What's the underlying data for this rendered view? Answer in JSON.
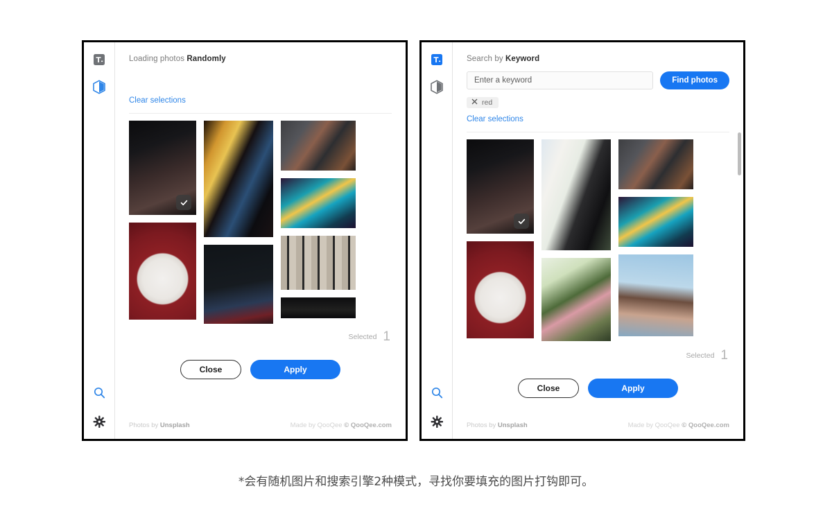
{
  "panels": [
    {
      "id": "random",
      "mode": "random",
      "header": {
        "prefix": "Loading photos ",
        "strong": "Randomly"
      },
      "show_search": false,
      "clear_label": "Clear selections",
      "selected": {
        "label": "Selected",
        "count": "1"
      },
      "buttons": {
        "close": "Close",
        "apply": "Apply"
      },
      "footer": {
        "left_prefix": "Photos by ",
        "left_strong": "Unsplash",
        "right_prefix": "Made by QooQee ",
        "right_symbol": "©",
        "right_strong": " QooQee.com"
      },
      "rail": {
        "text_icon": "text-tool-icon",
        "text_icon_active": false,
        "shape_icon": "hexagon-shape-icon",
        "shape_icon_active": true,
        "search_icon": "search-icon",
        "settings_icon": "gear-icon"
      },
      "scrollbar_visible": false,
      "photos": [
        {
          "name": "dark-building-corner",
          "col": 0,
          "h": 136,
          "selected": true,
          "theme": "building-dark"
        },
        {
          "name": "red-circle-bridge",
          "col": 0,
          "h": 140,
          "selected": false,
          "theme": "red-bridge"
        },
        {
          "name": "shop-window-night",
          "col": 1,
          "h": 168,
          "selected": false,
          "theme": "window-shop"
        },
        {
          "name": "car-hood-dark",
          "col": 1,
          "h": 120,
          "selected": false,
          "theme": "car-dark"
        },
        {
          "name": "person-on-couch",
          "col": 2,
          "h": 72,
          "selected": false,
          "theme": "couch"
        },
        {
          "name": "neon-diner-night",
          "col": 2,
          "h": 72,
          "selected": false,
          "theme": "diner"
        },
        {
          "name": "apartment-facade",
          "col": 2,
          "h": 78,
          "selected": false,
          "theme": "facade"
        },
        {
          "name": "dark-strip",
          "col": 2,
          "h": 30,
          "selected": false,
          "theme": "strip"
        }
      ]
    },
    {
      "id": "search",
      "mode": "keyword",
      "header": {
        "prefix": "Search by ",
        "strong": "Keyword"
      },
      "show_search": true,
      "search": {
        "placeholder": "Enter a keyword",
        "value": "",
        "button_label": "Find photos",
        "tags": [
          {
            "label": "red",
            "remove_icon": "close-x-icon"
          }
        ]
      },
      "clear_label": "Clear selections",
      "selected": {
        "label": "Selected",
        "count": "1"
      },
      "buttons": {
        "close": "Close",
        "apply": "Apply"
      },
      "footer": {
        "left_prefix": "Photos by ",
        "left_strong": "Unsplash",
        "right_prefix": "Made by QooQee ",
        "right_symbol": "©",
        "right_strong": " QooQee.com"
      },
      "rail": {
        "text_icon": "text-tool-icon",
        "text_icon_active": true,
        "shape_icon": "hexagon-shape-icon",
        "shape_icon_active": false,
        "search_icon": "search-icon",
        "settings_icon": "gear-icon"
      },
      "scrollbar_visible": true,
      "photos": [
        {
          "name": "dark-building-corner",
          "col": 0,
          "h": 136,
          "selected": true,
          "theme": "building-dark"
        },
        {
          "name": "red-circle-bridge",
          "col": 0,
          "h": 140,
          "selected": false,
          "theme": "red-bridge"
        },
        {
          "name": "wedding-hands",
          "col": 1,
          "h": 160,
          "selected": false,
          "theme": "wedding"
        },
        {
          "name": "woman-blossom",
          "col": 1,
          "h": 120,
          "selected": false,
          "theme": "blossom"
        },
        {
          "name": "person-on-couch",
          "col": 2,
          "h": 72,
          "selected": false,
          "theme": "couch"
        },
        {
          "name": "neon-diner-night",
          "col": 2,
          "h": 72,
          "selected": false,
          "theme": "diner"
        },
        {
          "name": "woman-drinking",
          "col": 2,
          "h": 118,
          "selected": false,
          "theme": "drinking"
        }
      ]
    }
  ],
  "caption": "*会有随机图片和搜索引擎2种模式，寻找你要填充的图片打钩即可。",
  "colors": {
    "accent": "#1877f2",
    "link": "#2f86e8",
    "border": "#000000",
    "muted": "#a7a7a7"
  }
}
